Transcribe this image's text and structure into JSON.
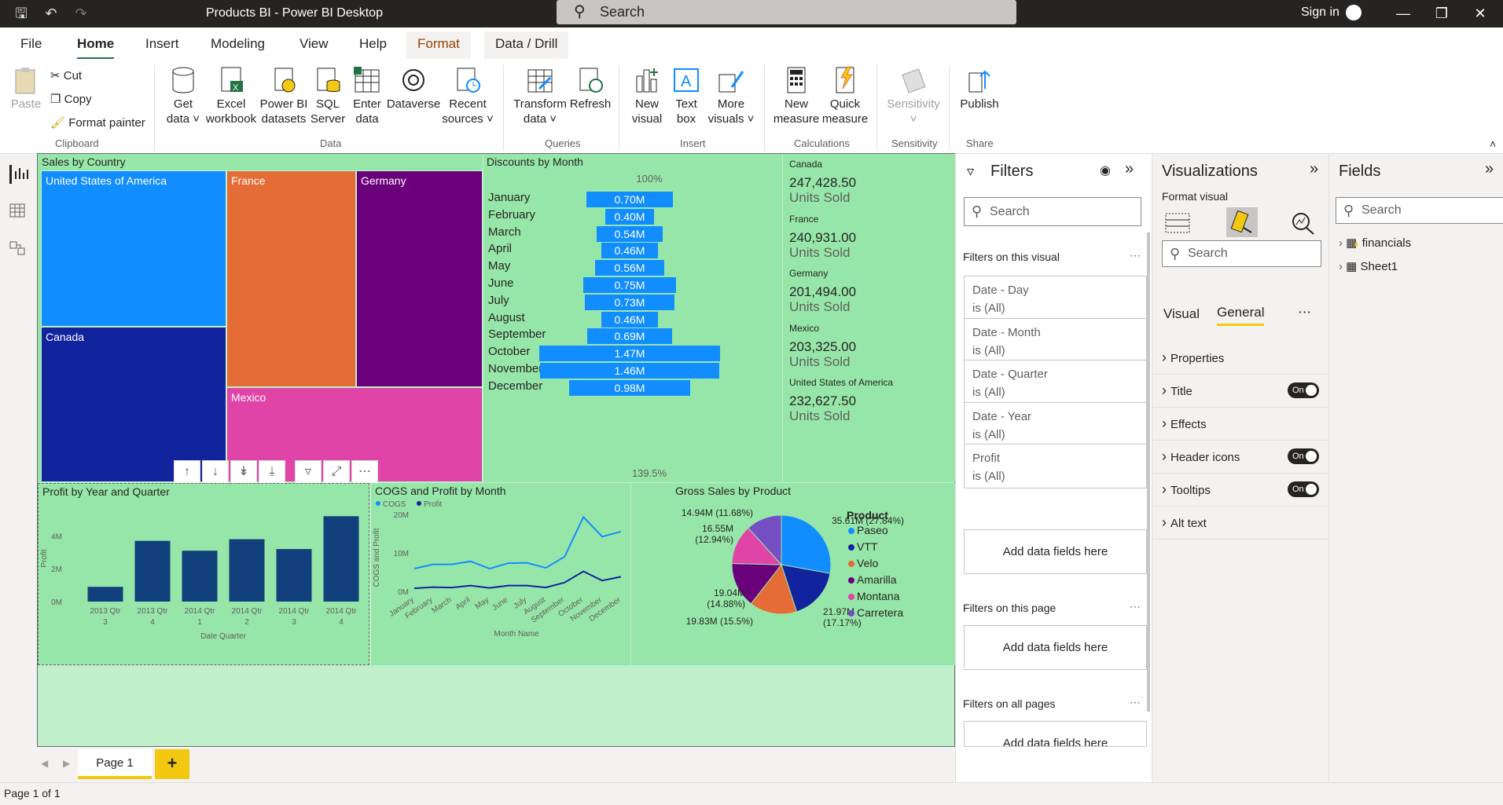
{
  "titlebar": {
    "title": "Products BI - Power BI Desktop",
    "search_placeholder": "Search",
    "sign_in": "Sign in"
  },
  "menu": {
    "items": [
      "File",
      "Home",
      "Insert",
      "Modeling",
      "View",
      "Help",
      "Format",
      "Data / Drill"
    ],
    "active": "Home"
  },
  "ribbon": {
    "clipboard": {
      "paste": "Paste",
      "cut": "Cut",
      "copy": "Copy",
      "format_painter": "Format painter",
      "label": "Clipboard"
    },
    "data": {
      "get_data": "Get data",
      "excel": "Excel workbook",
      "powerbi": "Power BI datasets",
      "sql": "SQL Server",
      "enter": "Enter data",
      "dataverse": "Dataverse",
      "recent": "Recent sources",
      "label": "Data"
    },
    "queries": {
      "transform": "Transform data",
      "refresh": "Refresh",
      "label": "Queries"
    },
    "insert": {
      "new_visual": "New visual",
      "text_box": "Text box",
      "more_visuals": "More visuals",
      "label": "Insert"
    },
    "calculations": {
      "new_measure": "New measure",
      "quick_measure": "Quick measure",
      "label": "Calculations"
    },
    "sensitivity": {
      "sensitivity": "Sensitivity",
      "label": "Sensitivity"
    },
    "share": {
      "publish": "Publish",
      "label": "Share"
    }
  },
  "report": {
    "treemap": {
      "title": "Sales by Country",
      "cells": [
        "United States of America",
        "France",
        "Germany",
        "Canada",
        "Mexico"
      ]
    },
    "funnel": {
      "title": "Discounts by Month",
      "top_label": "100%",
      "bottom_label": "139.5%"
    },
    "cards": {
      "unit": "Units Sold",
      "items": [
        {
          "category": "Canada",
          "value": "247,428.50"
        },
        {
          "category": "France",
          "value": "240,931.00"
        },
        {
          "category": "Germany",
          "value": "201,494.00"
        },
        {
          "category": "Mexico",
          "value": "203,325.00"
        },
        {
          "category": "United States of America",
          "value": "232,627.50"
        }
      ]
    },
    "profit_chart": {
      "title": "Profit by Year and Quarter"
    },
    "cogs_chart": {
      "title": "COGS and Profit by Month"
    },
    "pie_chart": {
      "title": "Gross Sales by Product"
    }
  },
  "chart_data": [
    {
      "type": "treemap",
      "title": "Sales by Country",
      "categories": [
        "United States of America",
        "Canada",
        "France",
        "Germany",
        "Mexico"
      ]
    },
    {
      "type": "funnel",
      "title": "Discounts by Month",
      "categories": [
        "January",
        "February",
        "March",
        "April",
        "May",
        "June",
        "July",
        "August",
        "September",
        "October",
        "November",
        "December"
      ],
      "values": [
        0.7,
        0.4,
        0.54,
        0.46,
        0.56,
        0.75,
        0.73,
        0.46,
        0.69,
        1.47,
        1.46,
        0.98
      ],
      "labels": [
        "0.70M",
        "0.40M",
        "0.54M",
        "0.46M",
        "0.56M",
        "0.75M",
        "0.73M",
        "0.46M",
        "0.69M",
        "1.47M",
        "1.46M",
        "0.98M"
      ],
      "top_label": "100%",
      "bottom_label": "139.5%"
    },
    {
      "type": "bar",
      "title": "Profit by Year and Quarter",
      "xlabel": "Date Quarter",
      "ylabel": "Profit",
      "categories": [
        "2013 Qtr 3",
        "2013 Qtr 4",
        "2014 Qtr 1",
        "2014 Qtr 2",
        "2014 Qtr 3",
        "2014 Qtr 4"
      ],
      "values": [
        0.9,
        3.7,
        3.1,
        3.8,
        3.2,
        5.2
      ],
      "yticks": [
        "0M",
        "2M",
        "4M"
      ],
      "ylim": [
        0,
        5.5
      ],
      "color": "#12407d"
    },
    {
      "type": "line",
      "title": "COGS and Profit by Month",
      "xlabel": "Month Name",
      "ylabel": "COGS and Profit",
      "categories": [
        "January",
        "February",
        "March",
        "April",
        "May",
        "June",
        "July",
        "August",
        "September",
        "October",
        "November",
        "December"
      ],
      "series": [
        {
          "name": "COGS",
          "values": [
            5.9,
            7.0,
            7.0,
            7.8,
            5.9,
            7.3,
            7.4,
            6.1,
            9.0,
            19.3,
            14.2,
            15.5
          ],
          "color": "#118dff"
        },
        {
          "name": "Profit",
          "values": [
            0.8,
            1.1,
            1.0,
            1.5,
            0.9,
            1.5,
            1.5,
            1.0,
            2.3,
            5.2,
            2.8,
            3.8
          ],
          "color": "#12239e"
        }
      ],
      "yticks": [
        "0M",
        "10M",
        "20M"
      ],
      "ylim": [
        0,
        22
      ]
    },
    {
      "type": "pie",
      "title": "Gross Sales by Product",
      "legend_title": "Product",
      "slices": [
        {
          "name": "Paseo",
          "value": 35.61,
          "label": "35.61M (27.84%)",
          "color": "#118dff"
        },
        {
          "name": "VTT",
          "value": 21.97,
          "label": "21.97M (17.17%)",
          "color": "#12239e"
        },
        {
          "name": "Velo",
          "value": 19.83,
          "label": "19.83M (15.5%)",
          "color": "#e66c37"
        },
        {
          "name": "Amarilla",
          "value": 19.04,
          "label": "19.04M (14.88%)",
          "color": "#6b007b"
        },
        {
          "name": "Montana",
          "value": 16.55,
          "label": "16.55M (12.94%)",
          "color": "#e044a7"
        },
        {
          "name": "Carretera",
          "value": 14.94,
          "label": "14.94M (11.68%)",
          "color": "#744ec2"
        }
      ]
    }
  ],
  "filters": {
    "title": "Filters",
    "search": "Search",
    "on_visual": "Filters on this visual",
    "on_page": "Filters on this page",
    "on_all": "Filters on all pages",
    "add": "Add data fields here",
    "cards": [
      {
        "name": "Date - Day",
        "state": "is (All)"
      },
      {
        "name": "Date - Month",
        "state": "is (All)"
      },
      {
        "name": "Date - Quarter",
        "state": "is (All)"
      },
      {
        "name": "Date - Year",
        "state": "is (All)"
      },
      {
        "name": "Profit",
        "state": "is (All)"
      }
    ]
  },
  "visualizations": {
    "title": "Visualizations",
    "format_visual": "Format visual",
    "search": "Search",
    "tab_visual": "Visual",
    "tab_general": "General",
    "rows": [
      {
        "label": "Properties",
        "toggle": ""
      },
      {
        "label": "Title",
        "toggle": "On"
      },
      {
        "label": "Effects",
        "toggle": ""
      },
      {
        "label": "Header icons",
        "toggle": "On"
      },
      {
        "label": "Tooltips",
        "toggle": "On"
      },
      {
        "label": "Alt text",
        "toggle": ""
      }
    ]
  },
  "fields": {
    "title": "Fields",
    "search": "Search",
    "tables": [
      "financials",
      "Sheet1"
    ]
  },
  "pages": {
    "tabs": [
      "Page 1"
    ],
    "add": "+"
  },
  "status": "Page 1 of 1"
}
